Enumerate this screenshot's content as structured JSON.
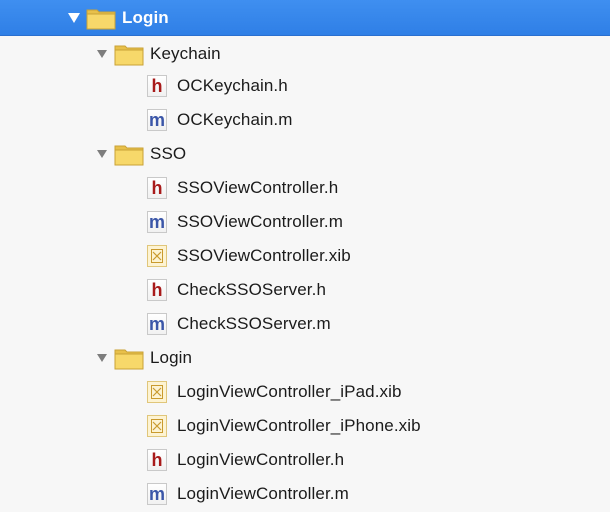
{
  "tree": {
    "root": {
      "label": "Login",
      "icon": "folder-icon",
      "expanded": true,
      "selected": true
    },
    "groups": [
      {
        "label": "Keychain",
        "icon": "folder-icon",
        "expanded": true,
        "files": [
          {
            "label": "OCKeychain.h",
            "type": "h"
          },
          {
            "label": "OCKeychain.m",
            "type": "m"
          }
        ]
      },
      {
        "label": "SSO",
        "icon": "folder-icon",
        "expanded": true,
        "files": [
          {
            "label": "SSOViewController.h",
            "type": "h"
          },
          {
            "label": "SSOViewController.m",
            "type": "m"
          },
          {
            "label": "SSOViewController.xib",
            "type": "xib"
          },
          {
            "label": "CheckSSOServer.h",
            "type": "h"
          },
          {
            "label": "CheckSSOServer.m",
            "type": "m"
          }
        ]
      },
      {
        "label": "Login",
        "icon": "folder-icon",
        "expanded": true,
        "files": [
          {
            "label": "LoginViewController_iPad.xib",
            "type": "xib"
          },
          {
            "label": "LoginViewController_iPhone.xib",
            "type": "xib"
          },
          {
            "label": "LoginViewController.h",
            "type": "h"
          },
          {
            "label": "LoginViewController.m",
            "type": "m"
          }
        ]
      }
    ]
  },
  "icon_letters": {
    "h": "h",
    "m": "m"
  },
  "colors": {
    "selection": "#3f8ff0",
    "header_file": "#a81a1a",
    "implementation_file": "#3b56a8",
    "folder": "#f2cf5b",
    "xib": "#fdf3d2"
  }
}
